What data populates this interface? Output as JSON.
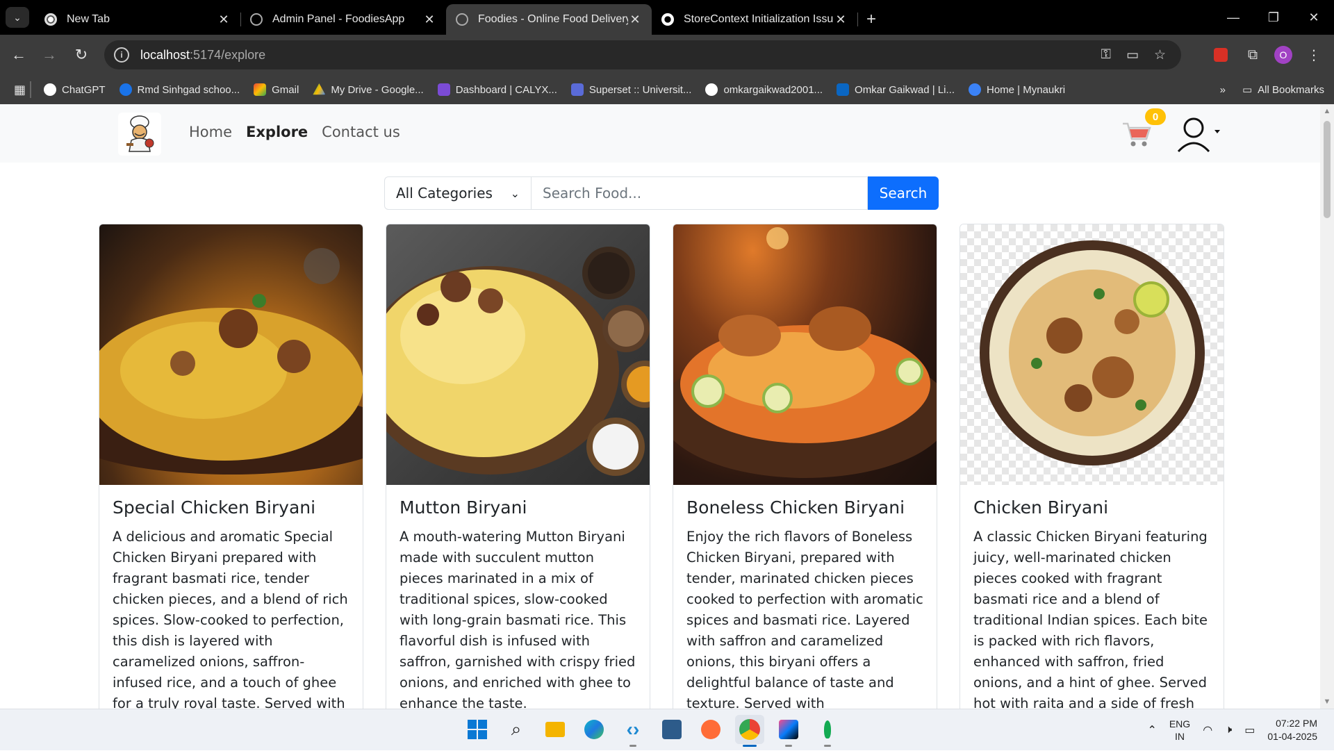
{
  "browser": {
    "tabs": [
      {
        "title": "New Tab",
        "icon": "chrome-icon",
        "active": false
      },
      {
        "title": "Admin Panel - FoodiesApp",
        "icon": "globe-icon",
        "active": false
      },
      {
        "title": "Foodies - Online Food Delivery",
        "icon": "globe-icon",
        "active": true
      },
      {
        "title": "StoreContext Initialization Issue",
        "icon": "openai-icon",
        "active": false
      }
    ],
    "url_host": "localhost",
    "url_path": ":5174/explore",
    "bookmarks": [
      {
        "label": "ChatGPT",
        "color": "#ffffff"
      },
      {
        "label": "Rmd Sinhgad schoo...",
        "color": "#1a73e8"
      },
      {
        "label": "Gmail",
        "color": "#ea4335"
      },
      {
        "label": "My Drive - Google...",
        "color": "#fbbc04"
      },
      {
        "label": "Dashboard | CALYX...",
        "color": "#7b4bd6"
      },
      {
        "label": "Superset :: Universit...",
        "color": "#5a6bd8"
      },
      {
        "label": "omkargaikwad2001...",
        "color": "#ffffff"
      },
      {
        "label": "Omkar Gaikwad | Li...",
        "color": "#0a66c2"
      },
      {
        "label": "Home | Mynaukri",
        "color": "#3b82f6"
      }
    ],
    "all_bookmarks": "All Bookmarks",
    "profile_initial": "O"
  },
  "navbar": {
    "links": [
      "Home",
      "Explore",
      "Contact us"
    ],
    "active_link": "Explore",
    "cart_count": "0"
  },
  "search": {
    "category": "All Categories",
    "placeholder": "Search Food...",
    "button": "Search"
  },
  "foods": [
    {
      "name": "Special Chicken Biryani",
      "description": "A delicious and aromatic Special Chicken Biryani prepared with fragrant basmati rice, tender chicken pieces, and a blend of rich spices. Slow-cooked to perfection, this dish is layered with caramelized onions, saffron-infused rice, and a touch of ghee for a truly royal taste. Served with"
    },
    {
      "name": "Mutton Biryani",
      "description": "A mouth-watering Mutton Biryani made with succulent mutton pieces marinated in a mix of traditional spices, slow-cooked with long-grain basmati rice. This flavorful dish is infused with saffron, garnished with crispy fried onions, and enriched with ghee to enhance the taste."
    },
    {
      "name": "Boneless Chicken Biryani",
      "description": "Enjoy the rich flavors of Boneless Chicken Biryani, prepared with tender, marinated chicken pieces cooked to perfection with aromatic spices and basmati rice. Layered with saffron and caramelized onions, this biryani offers a delightful balance of taste and texture. Served with"
    },
    {
      "name": "Chicken Biryani",
      "description": "A classic Chicken Biryani featuring juicy, well-marinated chicken pieces cooked with fragrant basmati rice and a blend of traditional Indian spices. Each bite is packed with rich flavors, enhanced with saffron, fried onions, and a hint of ghee. Served hot with raita and a side of fresh"
    }
  ],
  "taskbar": {
    "lang_top": "ENG",
    "lang_bottom": "IN",
    "time": "07:22 PM",
    "date": "01-04-2025"
  }
}
